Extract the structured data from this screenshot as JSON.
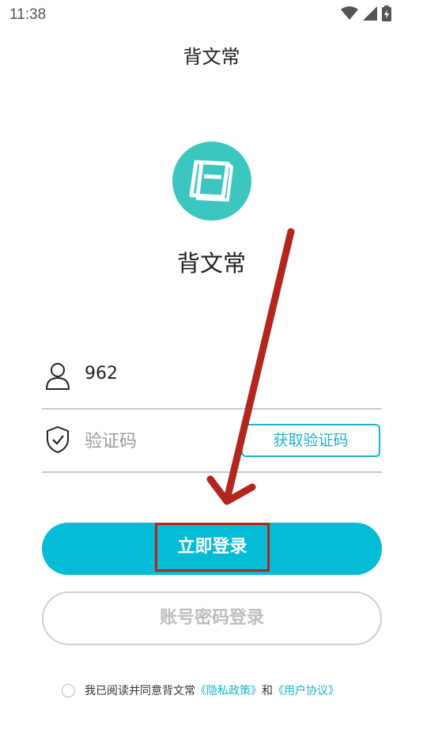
{
  "status_bar": {
    "time": "11:38",
    "icons": [
      "wifi-icon",
      "signal-icon",
      "battery-icon"
    ]
  },
  "header": {
    "title": "背文常"
  },
  "app": {
    "logo_icon": "book-icon",
    "logo_color": "#3cc6c0",
    "name": "背文常"
  },
  "form": {
    "phone": {
      "icon": "user-icon",
      "value": "962"
    },
    "code": {
      "icon": "shield-check-icon",
      "placeholder": "验证码",
      "get_code_label": "获取验证码"
    }
  },
  "buttons": {
    "login_label": "立即登录",
    "password_login_label": "账号密码登录"
  },
  "agreement": {
    "prefix": "我已阅读并同意背文常",
    "privacy_link": "《隐私政策》",
    "and": "和",
    "user_link": "《用户协议》"
  },
  "colors": {
    "accent": "#04bcd6",
    "annotation": "#b3261e"
  }
}
